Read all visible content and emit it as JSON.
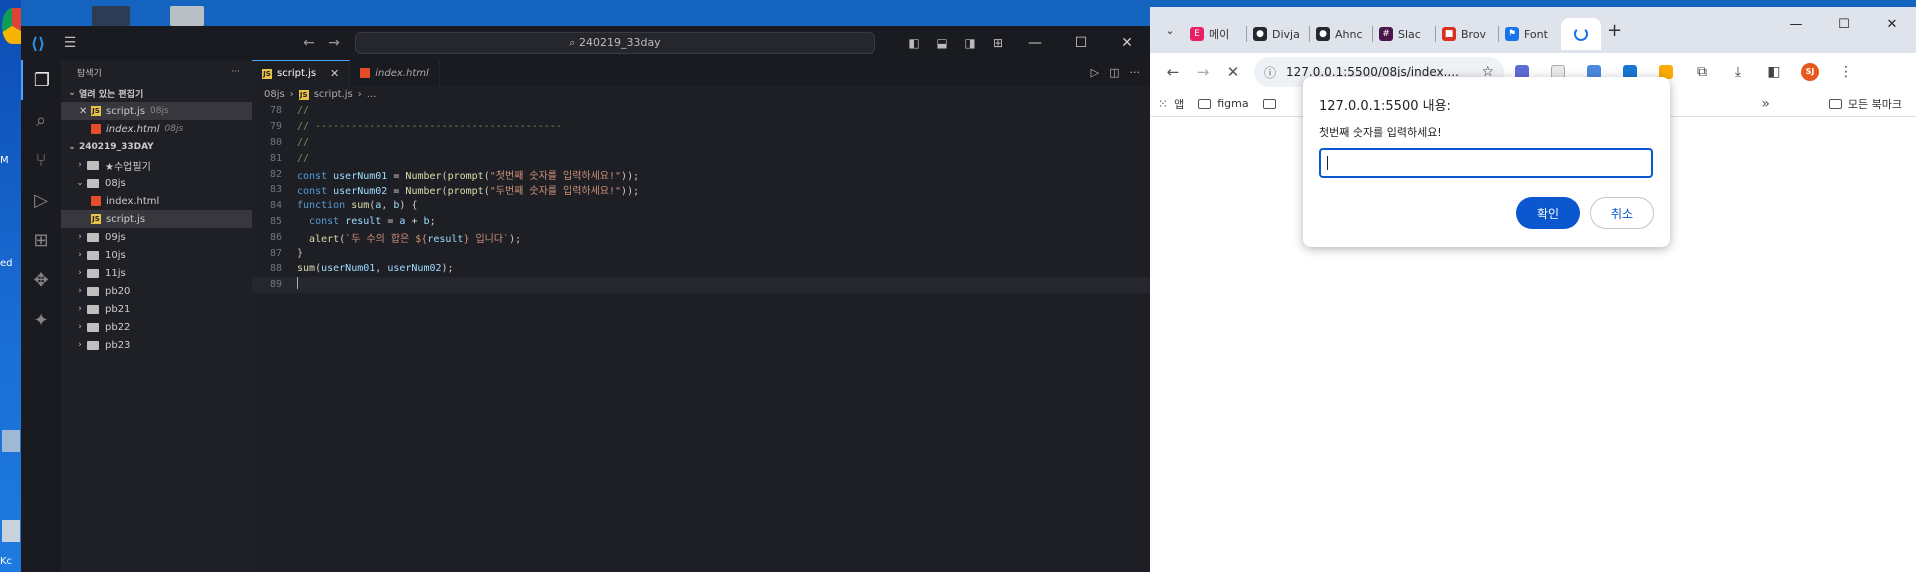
{
  "desktop": {
    "labels": [
      "M",
      "ed",
      "Kc"
    ]
  },
  "vscode": {
    "search": "240219_33day",
    "explorer": {
      "title": "탐색기",
      "open_editors_label": "열려 있는 편집기",
      "open_editors": [
        {
          "name": "script.js",
          "folder": "08js",
          "type": "js"
        },
        {
          "name": "index.html",
          "folder": "08js",
          "type": "html"
        }
      ],
      "workspace_label": "240219_33DAY",
      "tree": [
        {
          "label": "★수업필기",
          "kind": "folder",
          "depth": 1,
          "open": false
        },
        {
          "label": "08js",
          "kind": "folder",
          "depth": 1,
          "open": true
        },
        {
          "label": "index.html",
          "kind": "html",
          "depth": 2
        },
        {
          "label": "script.js",
          "kind": "js",
          "depth": 2,
          "selected": true
        },
        {
          "label": "09js",
          "kind": "folder",
          "depth": 1,
          "open": false
        },
        {
          "label": "10js",
          "kind": "folder",
          "depth": 1,
          "open": false
        },
        {
          "label": "11js",
          "kind": "folder",
          "depth": 1,
          "open": false
        },
        {
          "label": "pb20",
          "kind": "folder",
          "depth": 1,
          "open": false
        },
        {
          "label": "pb21",
          "kind": "folder",
          "depth": 1,
          "open": false
        },
        {
          "label": "pb22",
          "kind": "folder",
          "depth": 1,
          "open": false
        },
        {
          "label": "pb23",
          "kind": "folder",
          "depth": 1,
          "open": false
        }
      ]
    },
    "tabs": [
      {
        "label": "script.js",
        "active": true,
        "type": "js"
      },
      {
        "label": "index.html",
        "active": false,
        "type": "html"
      }
    ],
    "breadcrumb": {
      "folder": "08js",
      "file": "script.js",
      "more": "..."
    },
    "code_lines": [
      {
        "n": "78",
        "html": "<span class='cm'>//</span>"
      },
      {
        "n": "79",
        "html": "<span class='cm'>// -----------------------------------------</span>"
      },
      {
        "n": "80",
        "html": "<span class='cm'>//</span>"
      },
      {
        "n": "81",
        "html": "<span class='cm'>//</span>"
      },
      {
        "n": "82",
        "html": "<span class='kw'>const</span> <span class='var'>userNum01</span> <span class='op'>=</span> <span class='fn'>Number</span>(<span class='fn'>prompt</span>(<span class='str'>\"첫번째 숫자를 입력하세요!\"</span>));"
      },
      {
        "n": "83",
        "html": "<span class='kw'>const</span> <span class='var'>userNum02</span> <span class='op'>=</span> <span class='fn'>Number</span>(<span class='fn'>prompt</span>(<span class='str'>\"두번째 숫자를 입력하세요!\"</span>));"
      },
      {
        "n": "84",
        "html": "<span class='kw'>function</span> <span class='fn'>sum</span>(<span class='var'>a</span>, <span class='var'>b</span>) {"
      },
      {
        "n": "85",
        "html": "  <span class='kw'>const</span> <span class='var'>result</span> <span class='op'>=</span> <span class='var'>a</span> <span class='op'>+</span> <span class='var'>b</span>;"
      },
      {
        "n": "86",
        "html": "  <span class='fn'>alert</span>(<span class='str'>`두 수의 합은 ${</span><span class='var'>result</span><span class='str'>} 입니다`</span>);"
      },
      {
        "n": "87",
        "html": "}"
      },
      {
        "n": "88",
        "html": "<span class='fn'>sum</span>(<span class='var'>userNum01</span>, <span class='var'>userNum02</span>);"
      },
      {
        "n": "89",
        "html": "",
        "current": true
      }
    ]
  },
  "chrome": {
    "tabs": [
      {
        "label": "메이",
        "color": "#e91e63",
        "glyph": "E"
      },
      {
        "label": "Divja",
        "color": "#24292f",
        "glyph": "●"
      },
      {
        "label": "Ahnc",
        "color": "#24292f",
        "glyph": "●"
      },
      {
        "label": "Slac",
        "color": "#4a154b",
        "glyph": "#"
      },
      {
        "label": "Brov",
        "color": "#d93025",
        "glyph": "■"
      },
      {
        "label": "Font",
        "color": "#1a73e8",
        "glyph": "⚑"
      }
    ],
    "new_tab": "+",
    "url": "127.0.0.1:5500/08js/index....",
    "bookmarks": [
      {
        "label": "앱",
        "kind": "apps"
      },
      {
        "label": "figma",
        "kind": "folder"
      }
    ],
    "all_bookmarks": "모든 북마크",
    "profile_initials": "SJ",
    "dialog": {
      "title": "127.0.0.1:5500 내용:",
      "message": "첫번째 숫자를 입력하세요!",
      "input_value": "",
      "ok_label": "확인",
      "cancel_label": "취소"
    }
  },
  "colors": {
    "vscode_bg": "#1e1f25",
    "accent": "#0b57d0",
    "chrome_tabstrip": "#dfe3eb"
  }
}
